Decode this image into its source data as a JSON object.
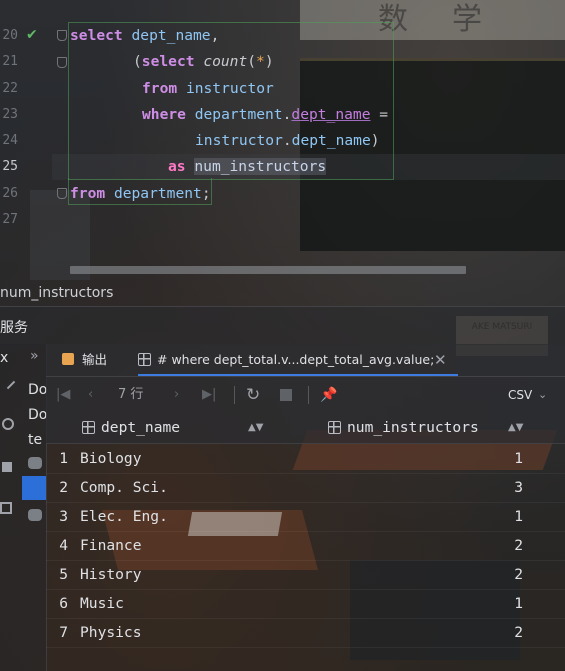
{
  "editor": {
    "line_numbers": [
      "20",
      "21",
      "22",
      "23",
      "24",
      "25",
      "26",
      "27"
    ],
    "current_line": "25",
    "code": {
      "l20": {
        "kw": "select",
        "sp": " ",
        "col": "dept_name",
        "punc": ","
      },
      "l21": {
        "open": "(",
        "kw": "select",
        "sp": " ",
        "fn": "count",
        "p1": "(",
        "star": "*",
        "p2": ")"
      },
      "l22": {
        "kw": "from",
        "sp": " ",
        "tbl": "instructor"
      },
      "l23": {
        "kw": "where",
        "sp": " ",
        "tbl": "department",
        "dot": ".",
        "fld": "dept_name",
        "eq": " ="
      },
      "l24": {
        "tbl": "instructor",
        "dot": ".",
        "fld": "dept_name",
        "close": ")"
      },
      "l25": {
        "kw": "as",
        "sp": " ",
        "alias": "num_instructors"
      },
      "l26": {
        "kw": "from",
        "sp": " ",
        "tbl": "department",
        "semi": ";"
      }
    }
  },
  "breadcrumb": "num_instructors",
  "services": {
    "title": "服务"
  },
  "left_strip": {
    "x_label": "x",
    "chevrons": "»",
    "items": [
      "Do",
      "Do",
      "te"
    ]
  },
  "tabs": [
    {
      "label": "输出",
      "icon": "output-icon"
    },
    {
      "label": "# where dept_total.v...dept_total_avg.value;",
      "icon": "table-icon",
      "active": true
    }
  ],
  "toolbar": {
    "row_count": "7 行",
    "csv": "CSV",
    "icons": [
      "first-page-icon",
      "prev-page-icon",
      "next-page-icon",
      "last-page-icon",
      "refresh-icon",
      "stop-icon",
      "pin-icon"
    ]
  },
  "result": {
    "columns": [
      "dept_name",
      "num_instructors"
    ],
    "rows": [
      {
        "n": "1",
        "dept_name": "Biology",
        "num": "1"
      },
      {
        "n": "2",
        "dept_name": "Comp. Sci.",
        "num": "3"
      },
      {
        "n": "3",
        "dept_name": "Elec. Eng.",
        "num": "1"
      },
      {
        "n": "4",
        "dept_name": "Finance",
        "num": "2"
      },
      {
        "n": "5",
        "dept_name": "History",
        "num": "2"
      },
      {
        "n": "6",
        "dept_name": "Music",
        "num": "1"
      },
      {
        "n": "7",
        "dept_name": "Physics",
        "num": "2"
      }
    ]
  },
  "background": {
    "chars": [
      "数",
      "学"
    ],
    "poster": "AKE MATSURI"
  }
}
